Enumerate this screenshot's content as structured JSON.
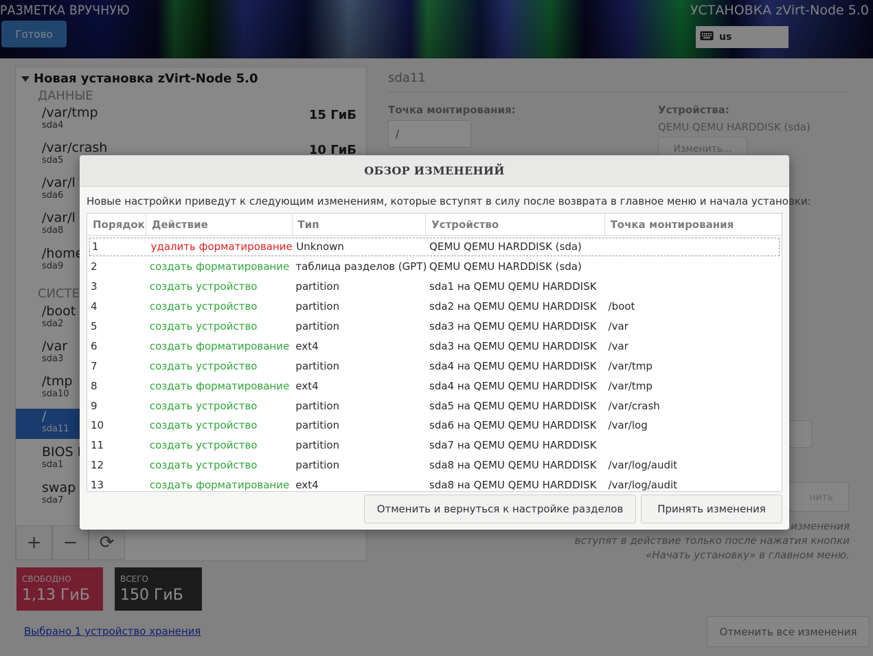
{
  "header": {
    "spoke_title": "РАЗМЕТКА ВРУЧНУЮ",
    "done_label": "Готово",
    "product_title": "УСТАНОВКА zVirt-Node 5.0",
    "keyboard_layout": "us",
    "keyboard_icon": "keyboard-icon"
  },
  "left": {
    "tree_title": "Новая установка zVirt-Node 5.0",
    "group_data": "ДАННЫЕ",
    "group_system": "СИСТЕ",
    "mounts": [
      {
        "name": "/var/tmp",
        "device": "sda4",
        "size": "15 ГиБ"
      },
      {
        "name": "/var/crash",
        "device": "sda5",
        "size": "10 ГиБ"
      },
      {
        "name": "/var/l",
        "device": "sda6"
      },
      {
        "name": "/var/l",
        "device": "sda8"
      },
      {
        "name": "/home",
        "device": "sda9"
      },
      {
        "name": "/boot",
        "device": "sda2"
      },
      {
        "name": "/var",
        "device": "sda3"
      },
      {
        "name": "/tmp",
        "device": "sda10"
      },
      {
        "name": "/",
        "device": "sda11"
      },
      {
        "name": "BIOS B",
        "device": "sda1"
      },
      {
        "name": "swap",
        "device": "sda7"
      }
    ],
    "toolbar": {
      "add": "+",
      "remove": "−",
      "refresh": "⟳"
    },
    "free_label": "СВОБОДНО",
    "free_value": "1,13 ГиБ",
    "total_label": "ВСЕГО",
    "total_value": "150 ГиБ",
    "storage_link": "Выбрано 1 устройство хранения",
    "reset_all": "Отменить все изменения"
  },
  "detail": {
    "title": "sda11",
    "mount_label": "Точка монтирования:",
    "mount_value": "/",
    "devices_label": "Устройства:",
    "devices_value": "QEMU QEMU HARDDISK (sda)",
    "modify_label": "Изменить...",
    "update_label": "нить",
    "note_lines": [
      "изменения",
      "вступят в действие только после нажатия кнопки",
      "«Начать установку» в главном меню."
    ]
  },
  "dialog": {
    "title": "ОБЗОР ИЗМЕНЕНИЙ",
    "text": "Новые настройки приведут к следующим изменениям, которые вступят в силу после возврата в главное меню и начала установки:",
    "columns": [
      "Порядок",
      "Действие",
      "Тип",
      "Устройство",
      "Точка монтирования"
    ],
    "rows": [
      [
        "1",
        "удалить форматирование",
        "Unknown",
        "QEMU QEMU HARDDISK (sda)",
        ""
      ],
      [
        "2",
        "создать форматирование",
        "таблица разделов (GPT)",
        "QEMU QEMU HARDDISK (sda)",
        ""
      ],
      [
        "3",
        "создать устройство",
        "partition",
        "sda1 на QEMU QEMU HARDDISK",
        ""
      ],
      [
        "4",
        "создать устройство",
        "partition",
        "sda2 на QEMU QEMU HARDDISK",
        "/boot"
      ],
      [
        "5",
        "создать устройство",
        "partition",
        "sda3 на QEMU QEMU HARDDISK",
        "/var"
      ],
      [
        "6",
        "создать форматирование",
        "ext4",
        "sda3 на QEMU QEMU HARDDISK",
        "/var"
      ],
      [
        "7",
        "создать устройство",
        "partition",
        "sda4 на QEMU QEMU HARDDISK",
        "/var/tmp"
      ],
      [
        "8",
        "создать форматирование",
        "ext4",
        "sda4 на QEMU QEMU HARDDISK",
        "/var/tmp"
      ],
      [
        "9",
        "создать устройство",
        "partition",
        "sda5 на QEMU QEMU HARDDISK",
        "/var/crash"
      ],
      [
        "10",
        "создать устройство",
        "partition",
        "sda6 на QEMU QEMU HARDDISK",
        "/var/log"
      ],
      [
        "11",
        "создать устройство",
        "partition",
        "sda7 на QEMU QEMU HARDDISK",
        ""
      ],
      [
        "12",
        "создать устройство",
        "partition",
        "sda8 на QEMU QEMU HARDDISK",
        "/var/log/audit"
      ],
      [
        "13",
        "создать форматирование",
        "ext4",
        "sda8 на QEMU QEMU HARDDISK",
        "/var/log/audit"
      ]
    ],
    "cancel_label": "Отменить и вернуться к настройке разделов",
    "accept_label": "Принять изменения",
    "colors": {
      "delete_action": "#e02020",
      "create_action": "#2fa63a"
    }
  }
}
